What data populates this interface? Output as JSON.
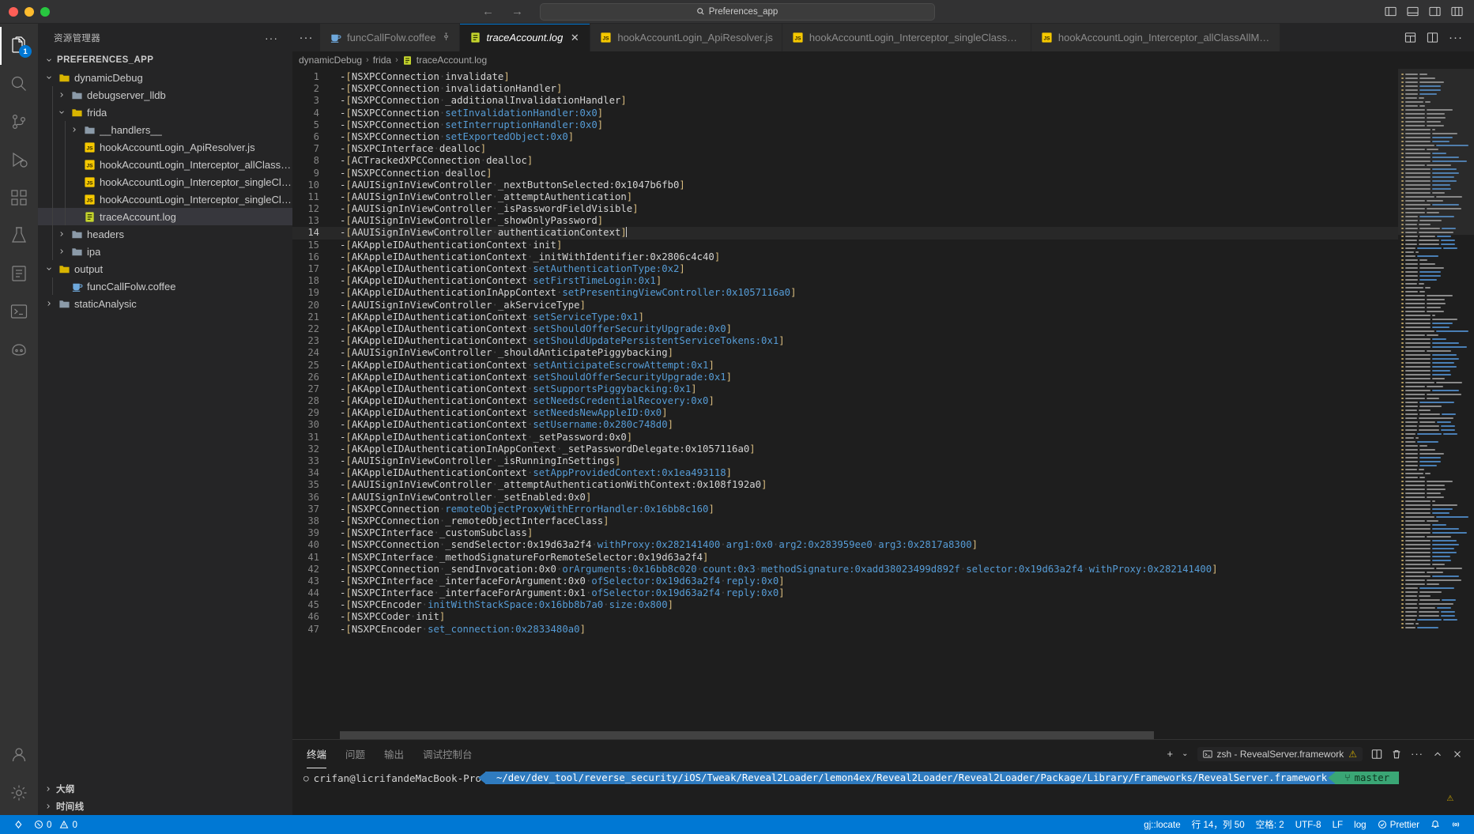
{
  "titlebar": {
    "quick_open_text": "Preferences_app",
    "back_arrow": "←",
    "forward_arrow": "→",
    "icons": [
      "panel-left-icon",
      "panel-bottom-icon",
      "panel-right-icon",
      "layout-icon"
    ]
  },
  "activitybar": {
    "items": [
      {
        "name": "explorer",
        "icon": "files-icon",
        "badge": "1",
        "active": true
      },
      {
        "name": "search",
        "icon": "search-icon",
        "badge": "",
        "active": false
      },
      {
        "name": "source-control",
        "icon": "source-control-icon",
        "badge": "",
        "active": false
      },
      {
        "name": "run-debug",
        "icon": "run-debug-icon",
        "badge": "",
        "active": false
      },
      {
        "name": "extensions",
        "icon": "extensions-icon",
        "badge": "",
        "active": false
      },
      {
        "name": "testing",
        "icon": "beaker-icon",
        "badge": "",
        "active": false
      },
      {
        "name": "todo",
        "icon": "book-icon",
        "badge": "",
        "active": false
      },
      {
        "name": "terminal-view",
        "icon": "terminal-icon",
        "badge": "",
        "active": false
      },
      {
        "name": "copilot",
        "icon": "copilot-icon",
        "badge": "",
        "active": false
      }
    ],
    "bottom": [
      {
        "name": "accounts",
        "icon": "account-icon"
      },
      {
        "name": "settings",
        "icon": "gear-icon"
      }
    ]
  },
  "sidebar": {
    "title": "资源管理器",
    "more_actions": "···",
    "root_label": "PREFERENCES_APP",
    "tree": [
      {
        "label": "dynamicDebug",
        "type": "folder-open",
        "depth": 1,
        "expanded": true,
        "selected": false
      },
      {
        "label": "debugserver_lldb",
        "type": "folder",
        "depth": 2,
        "expanded": false,
        "selected": false
      },
      {
        "label": "frida",
        "type": "folder-open",
        "depth": 2,
        "expanded": true,
        "selected": false
      },
      {
        "label": "__handlers__",
        "type": "folder",
        "depth": 3,
        "expanded": false,
        "selected": false
      },
      {
        "label": "hookAccountLogin_ApiResolver.js",
        "type": "js",
        "depth": 3,
        "expanded": null,
        "selected": false
      },
      {
        "label": "hookAccountLogin_Interceptor_allClassAllMetho...",
        "type": "js",
        "depth": 3,
        "expanded": null,
        "selected": false
      },
      {
        "label": "hookAccountLogin_Interceptor_singleClassAllMet...",
        "type": "js",
        "depth": 3,
        "expanded": null,
        "selected": false
      },
      {
        "label": "hookAccountLogin_Interceptor_singleClassSingle...",
        "type": "js",
        "depth": 3,
        "expanded": null,
        "selected": false
      },
      {
        "label": "traceAccount.log",
        "type": "log",
        "depth": 3,
        "expanded": null,
        "selected": true
      },
      {
        "label": "headers",
        "type": "folder",
        "depth": 2,
        "expanded": false,
        "selected": false
      },
      {
        "label": "ipa",
        "type": "folder",
        "depth": 2,
        "expanded": false,
        "selected": false
      },
      {
        "label": "output",
        "type": "folder-open",
        "depth": 1,
        "expanded": true,
        "selected": false
      },
      {
        "label": "funcCallFolw.coffee",
        "type": "coffee",
        "depth": 2,
        "expanded": null,
        "selected": false
      },
      {
        "label": "staticAnalysic",
        "type": "folder",
        "depth": 1,
        "expanded": false,
        "selected": false
      }
    ],
    "bottom_sections": [
      {
        "label": "大纲"
      },
      {
        "label": "时间线"
      }
    ]
  },
  "tabs": {
    "overflow_label": "···",
    "items": [
      {
        "label": "funcCallFolw.coffee",
        "icon": "coffee-icon",
        "active": false,
        "pinned": true,
        "closable": false
      },
      {
        "label": "traceAccount.log",
        "icon": "log-icon",
        "active": true,
        "pinned": false,
        "closable": true
      },
      {
        "label": "hookAccountLogin_ApiResolver.js",
        "icon": "js-icon",
        "active": false,
        "pinned": false,
        "closable": false
      },
      {
        "label": "hookAccountLogin_Interceptor_singleClassAllMethod.js",
        "icon": "js-icon",
        "active": false,
        "pinned": false,
        "closable": false
      },
      {
        "label": "hookAccountLogin_Interceptor_allClassAllMethod",
        "icon": "js-icon",
        "active": false,
        "pinned": false,
        "closable": false
      }
    ],
    "actions": [
      "split-layout-icon",
      "split-editor-icon",
      "more-actions-icon"
    ]
  },
  "breadcrumb": {
    "parts": [
      "dynamicDebug",
      "frida",
      "traceAccount.log"
    ],
    "separator": "›"
  },
  "editor": {
    "current_line": 14,
    "lines": [
      {
        "n": 1,
        "cls": "NSXPCConnection",
        "sel": "invalidate",
        "blue": false
      },
      {
        "n": 2,
        "cls": "NSXPCConnection",
        "sel": "invalidationHandler",
        "blue": false
      },
      {
        "n": 3,
        "cls": "NSXPCConnection",
        "sel": "_additionalInvalidationHandler",
        "blue": false
      },
      {
        "n": 4,
        "cls": "NSXPCConnection",
        "sel": "setInvalidationHandler:0x0",
        "blue": true
      },
      {
        "n": 5,
        "cls": "NSXPCConnection",
        "sel": "setInterruptionHandler:0x0",
        "blue": true
      },
      {
        "n": 6,
        "cls": "NSXPCConnection",
        "sel": "setExportedObject:0x0",
        "blue": true
      },
      {
        "n": 7,
        "cls": "NSXPCInterface",
        "sel": "dealloc",
        "blue": false
      },
      {
        "n": 8,
        "cls": "ACTrackedXPCConnection",
        "sel": "dealloc",
        "blue": false
      },
      {
        "n": 9,
        "cls": "NSXPCConnection",
        "sel": "dealloc",
        "blue": false
      },
      {
        "n": 10,
        "cls": "AAUISignInViewController",
        "sel": "_nextButtonSelected:0x1047b6fb0",
        "blue": false
      },
      {
        "n": 11,
        "cls": "AAUISignInViewController",
        "sel": "_attemptAuthentication",
        "blue": false
      },
      {
        "n": 12,
        "cls": "AAUISignInViewController",
        "sel": "_isPasswordFieldVisible",
        "blue": false
      },
      {
        "n": 13,
        "cls": "AAUISignInViewController",
        "sel": "_showOnlyPassword",
        "blue": false
      },
      {
        "n": 14,
        "cls": "AAUISignInViewController",
        "sel": "authenticationContext",
        "blue": false
      },
      {
        "n": 15,
        "cls": "AKAppleIDAuthenticationContext",
        "sel": "init",
        "blue": false
      },
      {
        "n": 16,
        "cls": "AKAppleIDAuthenticationContext",
        "sel": "_initWithIdentifier:0x2806c4c40",
        "blue": false
      },
      {
        "n": 17,
        "cls": "AKAppleIDAuthenticationContext",
        "sel": "setAuthenticationType:0x2",
        "blue": true
      },
      {
        "n": 18,
        "cls": "AKAppleIDAuthenticationContext",
        "sel": "setFirstTimeLogin:0x1",
        "blue": true
      },
      {
        "n": 19,
        "cls": "AKAppleIDAuthenticationInAppContext",
        "sel": "setPresentingViewController:0x1057116a0",
        "blue": true
      },
      {
        "n": 20,
        "cls": "AAUISignInViewController",
        "sel": "_akServiceType",
        "blue": false
      },
      {
        "n": 21,
        "cls": "AKAppleIDAuthenticationContext",
        "sel": "setServiceType:0x1",
        "blue": true
      },
      {
        "n": 22,
        "cls": "AKAppleIDAuthenticationContext",
        "sel": "setShouldOfferSecurityUpgrade:0x0",
        "blue": true
      },
      {
        "n": 23,
        "cls": "AKAppleIDAuthenticationContext",
        "sel": "setShouldUpdatePersistentServiceTokens:0x1",
        "blue": true
      },
      {
        "n": 24,
        "cls": "AAUISignInViewController",
        "sel": "_shouldAnticipatePiggybacking",
        "blue": false
      },
      {
        "n": 25,
        "cls": "AKAppleIDAuthenticationContext",
        "sel": "setAnticipateEscrowAttempt:0x1",
        "blue": true
      },
      {
        "n": 26,
        "cls": "AKAppleIDAuthenticationContext",
        "sel": "setShouldOfferSecurityUpgrade:0x1",
        "blue": true
      },
      {
        "n": 27,
        "cls": "AKAppleIDAuthenticationContext",
        "sel": "setSupportsPiggybacking:0x1",
        "blue": true
      },
      {
        "n": 28,
        "cls": "AKAppleIDAuthenticationContext",
        "sel": "setNeedsCredentialRecovery:0x0",
        "blue": true
      },
      {
        "n": 29,
        "cls": "AKAppleIDAuthenticationContext",
        "sel": "setNeedsNewAppleID:0x0",
        "blue": true
      },
      {
        "n": 30,
        "cls": "AKAppleIDAuthenticationContext",
        "sel": "setUsername:0x280c748d0",
        "blue": true
      },
      {
        "n": 31,
        "cls": "AKAppleIDAuthenticationContext",
        "sel": "_setPassword:0x0",
        "blue": false
      },
      {
        "n": 32,
        "cls": "AKAppleIDAuthenticationInAppContext",
        "sel": "_setPasswordDelegate:0x1057116a0",
        "blue": false
      },
      {
        "n": 33,
        "cls": "AAUISignInViewController",
        "sel": "_isRunningInSettings",
        "blue": false
      },
      {
        "n": 34,
        "cls": "AKAppleIDAuthenticationContext",
        "sel": "setAppProvidedContext:0x1ea493118",
        "blue": true
      },
      {
        "n": 35,
        "cls": "AAUISignInViewController",
        "sel": "_attemptAuthenticationWithContext:0x108f192a0",
        "blue": false
      },
      {
        "n": 36,
        "cls": "AAUISignInViewController",
        "sel": "_setEnabled:0x0",
        "blue": false
      },
      {
        "n": 37,
        "cls": "NSXPCConnection",
        "sel": "remoteObjectProxyWithErrorHandler:0x16bb8c160",
        "blue": true
      },
      {
        "n": 38,
        "cls": "NSXPCConnection",
        "sel": "_remoteObjectInterfaceClass",
        "blue": false
      },
      {
        "n": 39,
        "cls": "NSXPCInterface",
        "sel": "_customSubclass",
        "blue": false
      },
      {
        "n": 40,
        "cls": "NSXPCConnection",
        "sel": "_sendSelector:0x19d63a2f4",
        "blue": false,
        "extra": [
          {
            "t": "withProxy:0x282141400",
            "blue": true
          },
          {
            "t": "arg1:0x0",
            "blue": true
          },
          {
            "t": "arg2:0x283959ee0",
            "blue": true
          },
          {
            "t": "arg3:0x2817a8300",
            "blue": true
          }
        ]
      },
      {
        "n": 41,
        "cls": "NSXPCInterface",
        "sel": "_methodSignatureForRemoteSelector:0x19d63a2f4",
        "blue": false
      },
      {
        "n": 42,
        "cls": "NSXPCConnection",
        "sel": "_sendInvocation:0x0",
        "blue": false,
        "extra": [
          {
            "t": "orArguments:0x16bb8c020",
            "blue": true
          },
          {
            "t": "count:0x3",
            "blue": true
          },
          {
            "t": "methodSignature:0xadd38023499d892f",
            "blue": true
          },
          {
            "t": "selector:0x19d63a2f4",
            "blue": true
          },
          {
            "t": "withProxy:0x282141400",
            "blue": true
          }
        ]
      },
      {
        "n": 43,
        "cls": "NSXPCInterface",
        "sel": "_interfaceForArgument:0x0",
        "blue": false,
        "extra": [
          {
            "t": "ofSelector:0x19d63a2f4",
            "blue": true
          },
          {
            "t": "reply:0x0",
            "blue": true
          }
        ]
      },
      {
        "n": 44,
        "cls": "NSXPCInterface",
        "sel": "_interfaceForArgument:0x1",
        "blue": false,
        "extra": [
          {
            "t": "ofSelector:0x19d63a2f4",
            "blue": true
          },
          {
            "t": "reply:0x0",
            "blue": true
          }
        ]
      },
      {
        "n": 45,
        "cls": "NSXPCEncoder",
        "sel": "initWithStackSpace:0x16bb8b7a0",
        "blue": true,
        "extra": [
          {
            "t": "size:0x800",
            "blue": true
          }
        ]
      },
      {
        "n": 46,
        "cls": "NSXPCCoder",
        "sel": "init",
        "blue": false
      },
      {
        "n": 47,
        "cls": "NSXPCEncoder",
        "sel": "set_connection:0x2833480a0",
        "blue": true
      }
    ]
  },
  "panel": {
    "tabs": [
      {
        "label": "终端",
        "active": true
      },
      {
        "label": "问题",
        "active": false
      },
      {
        "label": "输出",
        "active": false
      },
      {
        "label": "调试控制台",
        "active": false
      }
    ],
    "add_label": "+",
    "chevron": "⌄",
    "terminal_name": "zsh - RevealServer.framework",
    "terminal_warn": "⚠",
    "actions": [
      "split-terminal-icon",
      "trash-icon",
      "more-actions-icon",
      "chevron-up-icon",
      "close-icon"
    ],
    "prompt": {
      "bullet": "○",
      "user": "crifan@licrifandeMacBook-Pro",
      "path": "~/dev/dev_tool/reverse_security/iOS/Tweak/Reveal2Loader/lemon4ex/Reveal2Loader/Reveal2Loader/Package/Library/Frameworks/RevealServer.framework",
      "git_branch": "master",
      "git_icon": "git-branch-icon"
    },
    "warning_icon": "⚠"
  },
  "statusbar": {
    "left": [
      {
        "name": "remote-indicator",
        "icon": "remote-icon",
        "label": ""
      },
      {
        "name": "problems",
        "icon": "error-icon",
        "label": "0"
      },
      {
        "name": "warnings",
        "icon": "warning-icon",
        "label": "0"
      }
    ],
    "error_count": "0",
    "warning_count": "0",
    "right": [
      {
        "name": "locate-status",
        "label": "gj::locate"
      },
      {
        "name": "cursor-position",
        "label": "行 14，列 50"
      },
      {
        "name": "indentation",
        "label": "空格: 2"
      },
      {
        "name": "encoding",
        "label": "UTF-8"
      },
      {
        "name": "eol",
        "label": "LF"
      },
      {
        "name": "language-mode",
        "label": "log"
      },
      {
        "name": "prettier",
        "label": "Prettier"
      },
      {
        "name": "notifications",
        "label": ""
      }
    ]
  },
  "colors": {
    "accent": "#0078d4",
    "bracket": "#d7ba7d",
    "selector_blue": "#569cd6",
    "text": "#d4d4d4",
    "terminal_path_bg": "#2f7bbf",
    "git_bg": "#3aa675"
  }
}
